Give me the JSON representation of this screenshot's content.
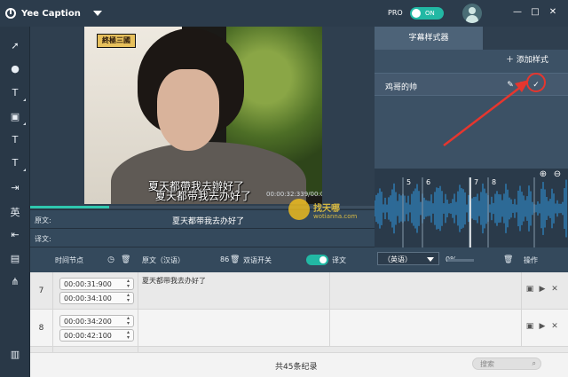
{
  "app": {
    "title": "Yee Caption",
    "pro_label": "PRO",
    "pro_toggle": "ON"
  },
  "window": {
    "min": "—",
    "max": "□",
    "close": "✕"
  },
  "video": {
    "logo_text": "終極三國",
    "subtitle_line1": "夏天都帶我去辦好了",
    "subtitle_line2": "夏天都带我去办好了",
    "timecode": "00:00:32:339/00:03:46:997",
    "progress_percent": 23
  },
  "original_row": {
    "label": "原文:",
    "text": "夏天都带我去办好了"
  },
  "translation_row": {
    "label": "译文:"
  },
  "watermark": {
    "line1": "找天哪",
    "line2": "wotianna.com"
  },
  "style_panel": {
    "tab": "字幕样式器",
    "add_label": "添加样式",
    "items": [
      {
        "name": "鸡哥的帅"
      }
    ]
  },
  "waveform": {
    "markers": [
      "5",
      "6",
      "7",
      "8"
    ]
  },
  "table": {
    "headers": {
      "timecode": "时间节点",
      "source": "原文（汉语）",
      "source_count": "86",
      "bilingual": "双语开关",
      "translation": "译文",
      "language": "（英语）",
      "percent": "0%",
      "ops": "操作"
    },
    "rows": [
      {
        "num": "7",
        "start": "00:00:31:900",
        "end": "00:00:34:100",
        "source": "夏天都带我去办好了",
        "translation": ""
      },
      {
        "num": "8",
        "start": "00:00:34:200",
        "end": "00:00:42:100",
        "source": "",
        "translation": ""
      }
    ]
  },
  "footer": {
    "count": "共45条纪录",
    "search_placeholder": "搜索"
  },
  "colors": {
    "accent": "#22b8a4",
    "annotation_red": "#e6362e",
    "header_bg": "#2c3c4c"
  }
}
